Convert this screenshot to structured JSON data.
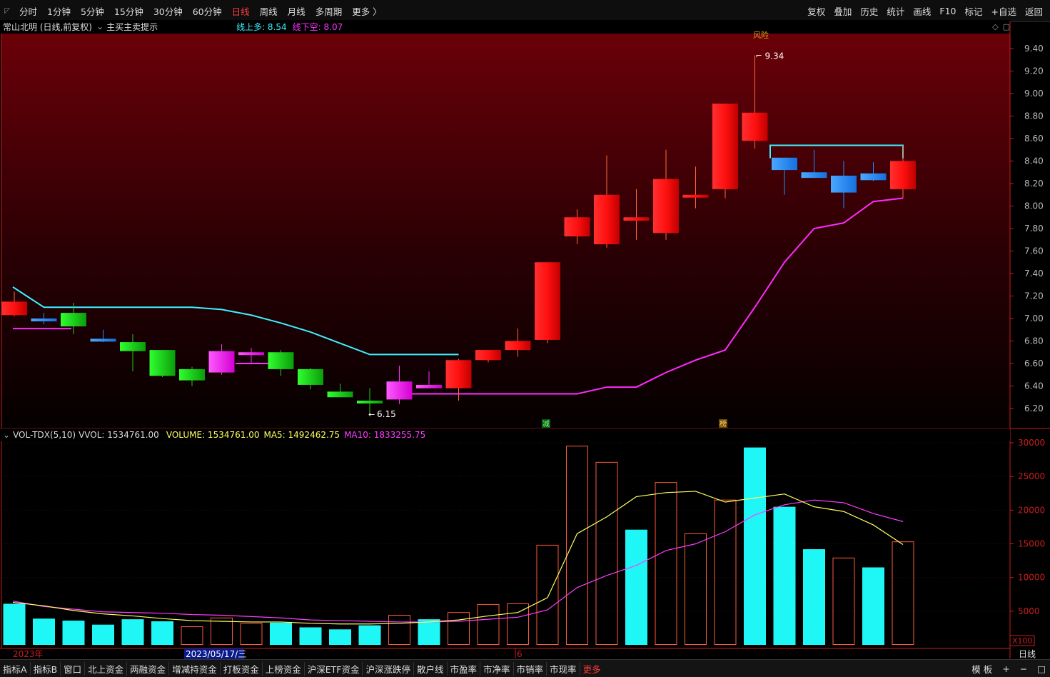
{
  "toolbar": {
    "periods": [
      "分时",
      "1分钟",
      "5分钟",
      "15分钟",
      "30分钟",
      "60分钟",
      "日线",
      "周线",
      "月线",
      "多周期",
      "更多 〉"
    ],
    "active_period": "日线",
    "right_buttons": [
      "复权",
      "叠加",
      "历史",
      "统计",
      "画线",
      "F10",
      "标记",
      "+自选",
      "返回"
    ]
  },
  "info": {
    "title": "常山北明 (日线,前复权)",
    "hint_label": "主买主卖提示",
    "up_label": "线上多: 8.54",
    "down_label": "线下空: 8.07"
  },
  "volume_panel": {
    "name": "VOL-TDX(5,10)",
    "vvol": "VVOL: 1534761.00",
    "volume": "VOLUME: 1534761.00",
    "ma5": "MA5: 1492462.75",
    "ma10": "MA10: 1833255.75",
    "axis_unit": "X100",
    "y_ticks": [
      "30000",
      "25000",
      "20000",
      "15000",
      "10000",
      "5000"
    ]
  },
  "price_axis": {
    "ticks": [
      "9.40",
      "9.20",
      "9.00",
      "8.80",
      "8.60",
      "8.40",
      "8.20",
      "8.00",
      "7.80",
      "7.60",
      "7.40",
      "7.20",
      "7.00",
      "6.80",
      "6.60",
      "6.40",
      "6.20"
    ]
  },
  "annotations": {
    "high_label": "9.34",
    "low_label": "6.15",
    "top_marker": "风险",
    "marker_jian": "减",
    "marker_bang": "榜"
  },
  "time_axis": {
    "year_label": "2023年",
    "cursor_date": "2023/05/17/三",
    "month_label": "6",
    "period_label": "日线"
  },
  "bottom": {
    "tabs": [
      "指标A",
      "指标B",
      "窗口",
      "北上资金",
      "两融资金",
      "增减持资金",
      "打板资金",
      "上榜资金",
      "沪深ETF资金",
      "沪深涨跌停",
      "散户线",
      "市盈率",
      "市净率",
      "市销率",
      "市现率"
    ],
    "more_label": "更多",
    "right_controls": [
      "模 板",
      "+",
      "−",
      "□"
    ]
  },
  "colors": {
    "up": "#ff1a1a",
    "down": "#17d417",
    "blue": "#1e90ff",
    "magenta": "#ff2bff",
    "cyan_line": "#3ff0ff",
    "vol_cyan": "#1ff6f6",
    "vol_outline": "#ff5a3c",
    "ma5": "#ffff60",
    "ma10": "#ff3dff",
    "axis_red": "#c81e1e"
  },
  "chart_data": {
    "type": "candlestick",
    "candles": [
      {
        "o": 7.15,
        "h": 7.24,
        "l": 7.02,
        "c": 7.03,
        "color": "up",
        "vol": 6100
      },
      {
        "o": 7.0,
        "h": 7.05,
        "l": 6.95,
        "c": 6.99,
        "color": "blue",
        "vol": 3900
      },
      {
        "o": 6.93,
        "h": 7.14,
        "l": 6.86,
        "c": 7.05,
        "color": "down",
        "vol": 3600
      },
      {
        "o": 6.82,
        "h": 6.9,
        "l": 6.79,
        "c": 6.8,
        "color": "blue",
        "vol": 3000
      },
      {
        "o": 6.79,
        "h": 6.86,
        "l": 6.53,
        "c": 6.71,
        "color": "down",
        "vol": 3800
      },
      {
        "o": 6.72,
        "h": 6.72,
        "l": 6.48,
        "c": 6.49,
        "color": "down",
        "vol": 3500
      },
      {
        "o": 6.55,
        "h": 6.57,
        "l": 6.4,
        "c": 6.45,
        "color": "down",
        "vol": 2700
      },
      {
        "o": 6.71,
        "h": 6.77,
        "l": 6.5,
        "c": 6.52,
        "color": "magenta",
        "vol": 4000
      },
      {
        "o": 6.7,
        "h": 6.74,
        "l": 6.6,
        "c": 6.68,
        "color": "magenta",
        "vol": 3200
      },
      {
        "o": 6.7,
        "h": 6.72,
        "l": 6.49,
        "c": 6.55,
        "color": "down",
        "vol": 3300
      },
      {
        "o": 6.55,
        "h": 6.56,
        "l": 6.37,
        "c": 6.41,
        "color": "down",
        "vol": 2600
      },
      {
        "o": 6.35,
        "h": 6.42,
        "l": 6.32,
        "c": 6.3,
        "color": "down",
        "vol": 2300
      },
      {
        "o": 6.27,
        "h": 6.38,
        "l": 6.15,
        "c": 6.25,
        "color": "down",
        "vol": 2900
      },
      {
        "o": 6.28,
        "h": 6.58,
        "l": 6.24,
        "c": 6.44,
        "color": "magenta",
        "vol": 4400
      },
      {
        "o": 6.41,
        "h": 6.53,
        "l": 6.39,
        "c": 6.38,
        "color": "magenta",
        "vol": 3800
      },
      {
        "o": 6.38,
        "h": 6.64,
        "l": 6.27,
        "c": 6.63,
        "color": "up",
        "vol": 4800
      },
      {
        "o": 6.63,
        "h": 6.72,
        "l": 6.61,
        "c": 6.72,
        "color": "up",
        "vol": 6000
      },
      {
        "o": 6.72,
        "h": 6.91,
        "l": 6.66,
        "c": 6.8,
        "color": "up",
        "vol": 6100
      },
      {
        "o": 6.81,
        "h": 7.5,
        "l": 6.78,
        "c": 7.5,
        "color": "up",
        "vol": 14800
      },
      {
        "o": 7.73,
        "h": 7.97,
        "l": 7.66,
        "c": 7.9,
        "color": "up",
        "vol": 29500
      },
      {
        "o": 7.66,
        "h": 8.45,
        "l": 7.63,
        "c": 8.1,
        "color": "up",
        "vol": 27100
      },
      {
        "o": 7.87,
        "h": 8.15,
        "l": 7.7,
        "c": 7.9,
        "color": "up",
        "vol": 17100
      },
      {
        "o": 7.76,
        "h": 8.5,
        "l": 7.7,
        "c": 8.24,
        "color": "up",
        "vol": 24100
      },
      {
        "o": 8.08,
        "h": 8.35,
        "l": 7.98,
        "c": 8.1,
        "color": "up",
        "vol": 16500
      },
      {
        "o": 8.15,
        "h": 8.91,
        "l": 8.07,
        "c": 8.91,
        "color": "up",
        "vol": 21500
      },
      {
        "o": 8.58,
        "h": 9.34,
        "l": 8.51,
        "c": 8.83,
        "color": "up",
        "vol": 29300
      },
      {
        "o": 8.43,
        "h": 8.43,
        "l": 8.1,
        "c": 8.32,
        "color": "blue",
        "vol": 20500
      },
      {
        "o": 8.3,
        "h": 8.5,
        "l": 8.25,
        "c": 8.25,
        "color": "blue",
        "vol": 14200
      },
      {
        "o": 8.27,
        "h": 8.4,
        "l": 7.98,
        "c": 8.12,
        "color": "blue",
        "vol": 12900
      },
      {
        "o": 8.29,
        "h": 8.39,
        "l": 8.22,
        "c": 8.23,
        "color": "blue",
        "vol": 11500
      },
      {
        "o": 8.15,
        "h": 8.54,
        "l": 8.07,
        "c": 8.4,
        "color": "up",
        "vol": 15300
      }
    ],
    "vol_style": [
      "filled",
      "filled",
      "filled",
      "filled",
      "filled",
      "filled",
      "hollow",
      "hollow",
      "hollow",
      "filled",
      "filled",
      "filled",
      "filled",
      "hollow",
      "filled",
      "hollow",
      "hollow",
      "hollow",
      "hollow",
      "hollow",
      "hollow",
      "filled",
      "hollow",
      "hollow",
      "hollow",
      "filled",
      "filled",
      "filled",
      "hollow",
      "filled",
      "hollow"
    ],
    "upper_line": [
      7.28,
      7.1,
      7.1,
      7.1,
      7.1,
      7.1,
      7.1,
      7.08,
      7.03,
      6.96,
      6.88,
      6.78,
      6.68,
      6.68,
      6.68,
      6.68
    ],
    "upper_line_late": {
      "start": 26,
      "values": [
        8.54,
        8.54,
        8.54,
        8.54,
        8.54
      ]
    },
    "lower_line": {
      "start": 0,
      "values": [
        6.91,
        6.91,
        6.91,
        null,
        null,
        null,
        null,
        6.6,
        6.6,
        6.6,
        null,
        null,
        null,
        6.33,
        6.33,
        6.33,
        6.33,
        6.33,
        6.33,
        6.33,
        6.39,
        6.39,
        6.52,
        6.63,
        6.72,
        7.1,
        7.5,
        7.8,
        7.85,
        8.04,
        8.07
      ]
    },
    "ma5": [
      6300,
      5800,
      5100,
      4600,
      4300,
      3900,
      3600,
      3500,
      3400,
      3400,
      3200,
      3100,
      3100,
      3200,
      3400,
      3700,
      4300,
      4800,
      7000,
      16500,
      19000,
      22000,
      22600,
      22800,
      21200,
      21800,
      22400,
      20500,
      19800,
      17800,
      14900
    ],
    "ma10": [
      6500,
      5700,
      5300,
      4900,
      4800,
      4700,
      4500,
      4400,
      4200,
      4000,
      3700,
      3600,
      3500,
      3400,
      3400,
      3500,
      3800,
      4100,
      5200,
      8500,
      10300,
      11800,
      14000,
      15000,
      16800,
      19300,
      20800,
      21500,
      21100,
      19500,
      18300
    ],
    "x_axis": "trading days",
    "ylim_price": [
      6.1,
      9.5
    ],
    "ylim_volume": [
      0,
      30000
    ]
  }
}
